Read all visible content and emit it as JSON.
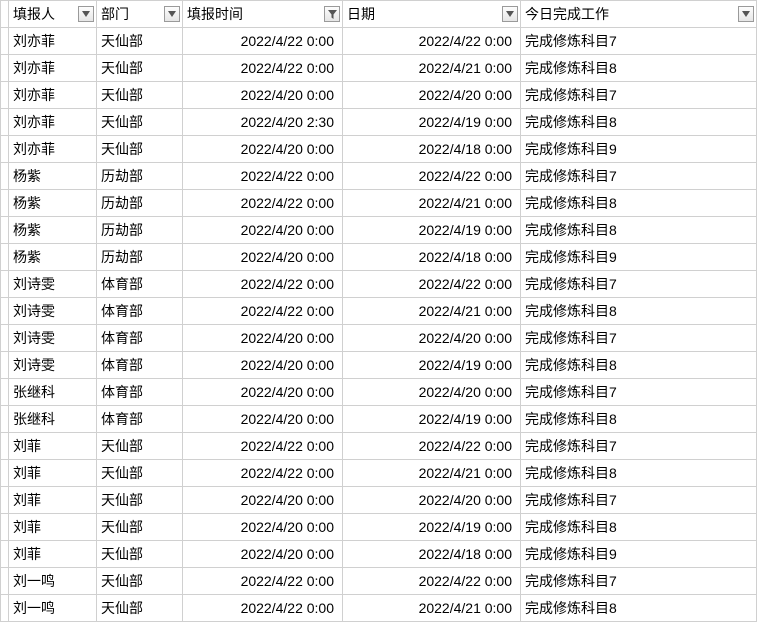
{
  "headers": {
    "name": "填报人",
    "dept": "部门",
    "time": "填报时间",
    "date": "日期",
    "work": "今日完成工作"
  },
  "rows": [
    {
      "name": "刘亦菲",
      "dept": "天仙部",
      "time": "2022/4/22 0:00",
      "date": "2022/4/22 0:00",
      "work": "完成修炼科目7"
    },
    {
      "name": "刘亦菲",
      "dept": "天仙部",
      "time": "2022/4/22 0:00",
      "date": "2022/4/21 0:00",
      "work": "完成修炼科目8"
    },
    {
      "name": "刘亦菲",
      "dept": "天仙部",
      "time": "2022/4/20 0:00",
      "date": "2022/4/20 0:00",
      "work": "完成修炼科目7"
    },
    {
      "name": "刘亦菲",
      "dept": "天仙部",
      "time": "2022/4/20 2:30",
      "date": "2022/4/19 0:00",
      "work": "完成修炼科目8"
    },
    {
      "name": "刘亦菲",
      "dept": "天仙部",
      "time": "2022/4/20 0:00",
      "date": "2022/4/18 0:00",
      "work": "完成修炼科目9"
    },
    {
      "name": "杨紫",
      "dept": "历劫部",
      "time": "2022/4/22 0:00",
      "date": "2022/4/22 0:00",
      "work": "完成修炼科目7"
    },
    {
      "name": "杨紫",
      "dept": "历劫部",
      "time": "2022/4/22 0:00",
      "date": "2022/4/21 0:00",
      "work": "完成修炼科目8"
    },
    {
      "name": "杨紫",
      "dept": "历劫部",
      "time": "2022/4/20 0:00",
      "date": "2022/4/19 0:00",
      "work": "完成修炼科目8"
    },
    {
      "name": "杨紫",
      "dept": "历劫部",
      "time": "2022/4/20 0:00",
      "date": "2022/4/18 0:00",
      "work": "完成修炼科目9"
    },
    {
      "name": "刘诗雯",
      "dept": "体育部",
      "time": "2022/4/22 0:00",
      "date": "2022/4/22 0:00",
      "work": "完成修炼科目7"
    },
    {
      "name": "刘诗雯",
      "dept": "体育部",
      "time": "2022/4/22 0:00",
      "date": "2022/4/21 0:00",
      "work": "完成修炼科目8"
    },
    {
      "name": "刘诗雯",
      "dept": "体育部",
      "time": "2022/4/20 0:00",
      "date": "2022/4/20 0:00",
      "work": "完成修炼科目7"
    },
    {
      "name": "刘诗雯",
      "dept": "体育部",
      "time": "2022/4/20 0:00",
      "date": "2022/4/19 0:00",
      "work": "完成修炼科目8"
    },
    {
      "name": "张继科",
      "dept": "体育部",
      "time": "2022/4/20 0:00",
      "date": "2022/4/20 0:00",
      "work": "完成修炼科目7"
    },
    {
      "name": "张继科",
      "dept": "体育部",
      "time": "2022/4/20 0:00",
      "date": "2022/4/19 0:00",
      "work": "完成修炼科目8"
    },
    {
      "name": "刘菲",
      "dept": "天仙部",
      "time": "2022/4/22 0:00",
      "date": "2022/4/22 0:00",
      "work": "完成修炼科目7"
    },
    {
      "name": "刘菲",
      "dept": "天仙部",
      "time": "2022/4/22 0:00",
      "date": "2022/4/21 0:00",
      "work": "完成修炼科目8"
    },
    {
      "name": "刘菲",
      "dept": "天仙部",
      "time": "2022/4/20 0:00",
      "date": "2022/4/20 0:00",
      "work": "完成修炼科目7"
    },
    {
      "name": "刘菲",
      "dept": "天仙部",
      "time": "2022/4/20 0:00",
      "date": "2022/4/19 0:00",
      "work": "完成修炼科目8"
    },
    {
      "name": "刘菲",
      "dept": "天仙部",
      "time": "2022/4/20 0:00",
      "date": "2022/4/18 0:00",
      "work": "完成修炼科目9"
    },
    {
      "name": "刘一鸣",
      "dept": "天仙部",
      "time": "2022/4/22 0:00",
      "date": "2022/4/22 0:00",
      "work": "完成修炼科目7"
    },
    {
      "name": "刘一鸣",
      "dept": "天仙部",
      "time": "2022/4/22 0:00",
      "date": "2022/4/21 0:00",
      "work": "完成修炼科目8"
    }
  ]
}
